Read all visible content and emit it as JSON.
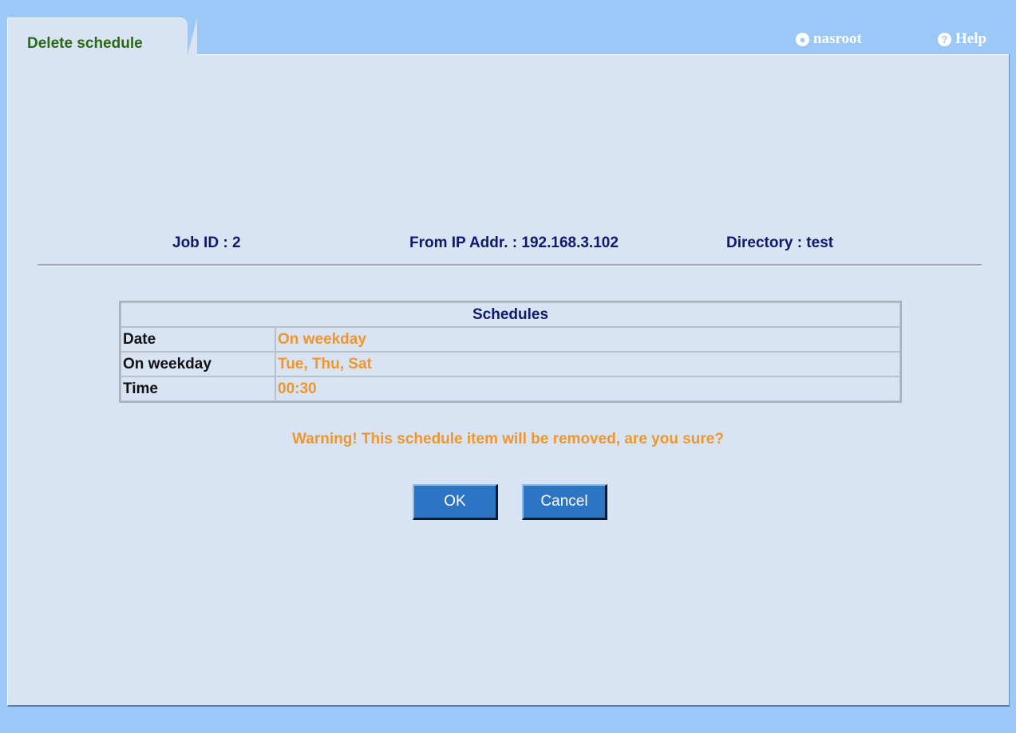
{
  "tab": {
    "title": "Delete schedule"
  },
  "header": {
    "user": "nasroot",
    "help": "Help"
  },
  "info": {
    "job_id": "Job ID : 2",
    "from_ip": "From IP Addr. : 192.168.3.102",
    "directory": "Directory : test"
  },
  "schedules": {
    "title": "Schedules",
    "rows": [
      {
        "label": "Date",
        "value": "On weekday"
      },
      {
        "label": "On weekday",
        "value": "Tue, Thu, Sat"
      },
      {
        "label": "Time",
        "value": "00:30"
      }
    ]
  },
  "warning": "Warning! This schedule item will be removed, are you sure?",
  "buttons": {
    "ok": "OK",
    "cancel": "Cancel"
  }
}
